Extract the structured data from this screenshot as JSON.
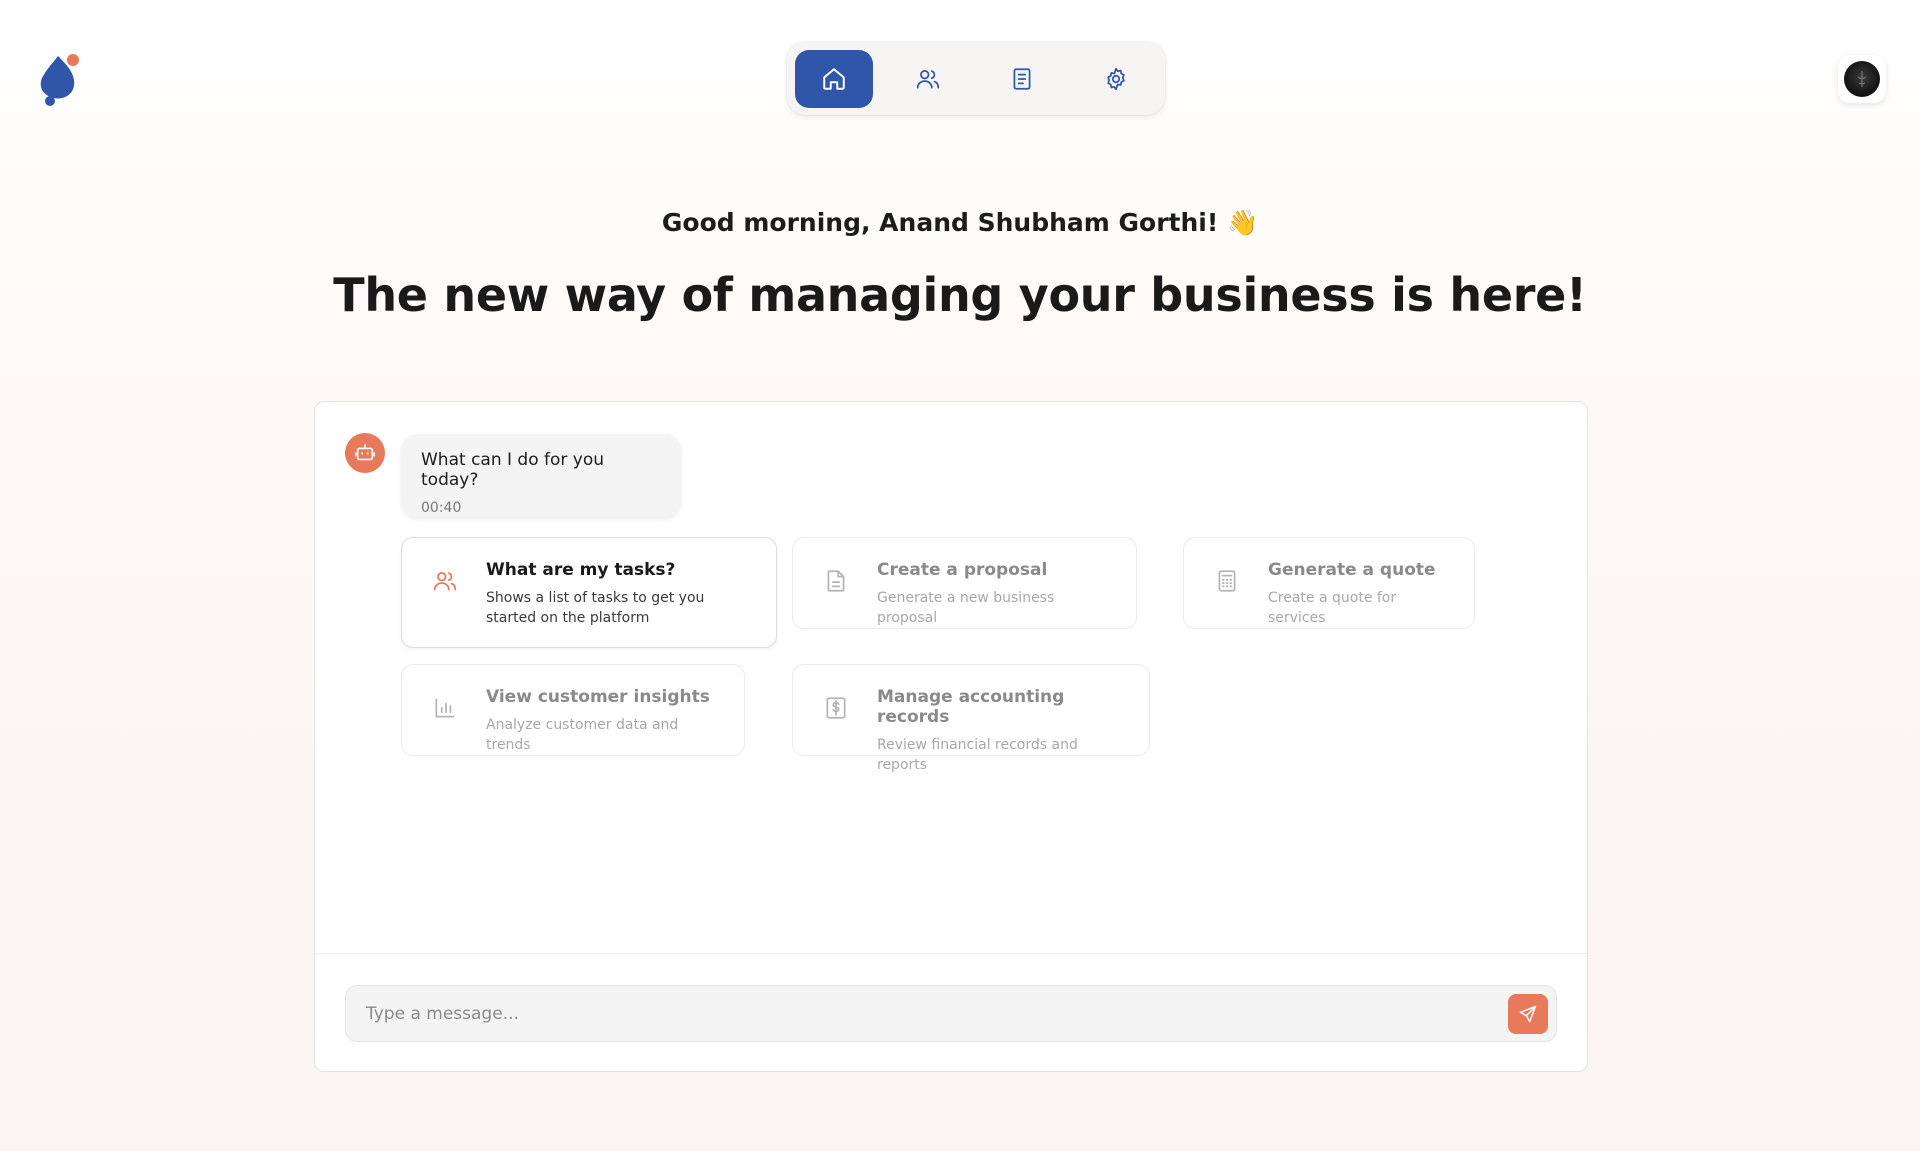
{
  "app": {
    "logo": "app-logo-icon"
  },
  "nav": {
    "items": [
      {
        "icon": "home-icon",
        "active": true
      },
      {
        "icon": "users-icon",
        "active": false
      },
      {
        "icon": "receipt-icon",
        "active": false
      },
      {
        "icon": "gear-icon",
        "active": false
      }
    ],
    "accent_color": "#2f56a8"
  },
  "user": {
    "avatar": "user-avatar"
  },
  "hero": {
    "greeting": "Good morning, Anand Shubham Gorthi! 👋",
    "headline": "The new way of managing your business is here!"
  },
  "chat": {
    "bot_icon": "robot-icon",
    "message": {
      "text": "What can I do for you today?",
      "time": "00:40"
    },
    "suggestions": [
      {
        "icon": "users-icon",
        "title": "What are my tasks?",
        "desc": "Shows a list of tasks to get you started on the platform"
      },
      {
        "icon": "document-icon",
        "title": "Create a proposal",
        "desc": "Generate a new business proposal"
      },
      {
        "icon": "calculator-icon",
        "title": "Generate a quote",
        "desc": "Create a quote for services"
      },
      {
        "icon": "bar-chart-icon",
        "title": "View customer insights",
        "desc": "Analyze customer data and trends"
      },
      {
        "icon": "dollar-receipt-icon",
        "title": "Manage accounting records",
        "desc": "Review financial records and reports"
      }
    ],
    "composer": {
      "placeholder": "Type a message...",
      "send_icon": "send-icon"
    },
    "accent_color": "#e8795a"
  }
}
